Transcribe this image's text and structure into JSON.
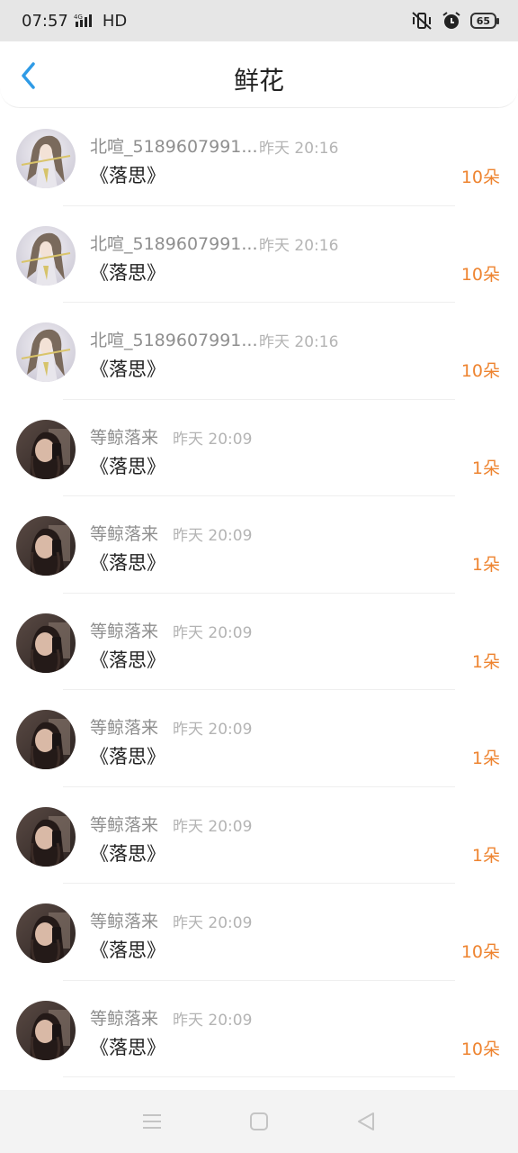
{
  "status_bar": {
    "time": "07:57",
    "network": "HD",
    "battery": "65"
  },
  "nav": {
    "title": "鲜花"
  },
  "items": [
    {
      "name": "北喧_5189607991...",
      "time": "昨天 20:16",
      "work": "《落思》",
      "count": "10朵",
      "avatar": "avatar-anime"
    },
    {
      "name": "北喧_5189607991...",
      "time": "昨天 20:16",
      "work": "《落思》",
      "count": "10朵",
      "avatar": "avatar-anime"
    },
    {
      "name": "北喧_5189607991...",
      "time": "昨天 20:16",
      "work": "《落思》",
      "count": "10朵",
      "avatar": "avatar-anime"
    },
    {
      "name": "等鲸落来",
      "time": "昨天 20:09",
      "work": "《落思》",
      "count": "1朵",
      "avatar": "avatar-photo"
    },
    {
      "name": "等鲸落来",
      "time": "昨天 20:09",
      "work": "《落思》",
      "count": "1朵",
      "avatar": "avatar-photo"
    },
    {
      "name": "等鲸落来",
      "time": "昨天 20:09",
      "work": "《落思》",
      "count": "1朵",
      "avatar": "avatar-photo"
    },
    {
      "name": "等鲸落来",
      "time": "昨天 20:09",
      "work": "《落思》",
      "count": "1朵",
      "avatar": "avatar-photo"
    },
    {
      "name": "等鲸落来",
      "time": "昨天 20:09",
      "work": "《落思》",
      "count": "1朵",
      "avatar": "avatar-photo"
    },
    {
      "name": "等鲸落来",
      "time": "昨天 20:09",
      "work": "《落思》",
      "count": "10朵",
      "avatar": "avatar-photo"
    },
    {
      "name": "等鲸落来",
      "time": "昨天 20:09",
      "work": "《落思》",
      "count": "10朵",
      "avatar": "avatar-photo"
    }
  ],
  "colors": {
    "accent": "#2f9be6",
    "count": "#ee8430"
  }
}
